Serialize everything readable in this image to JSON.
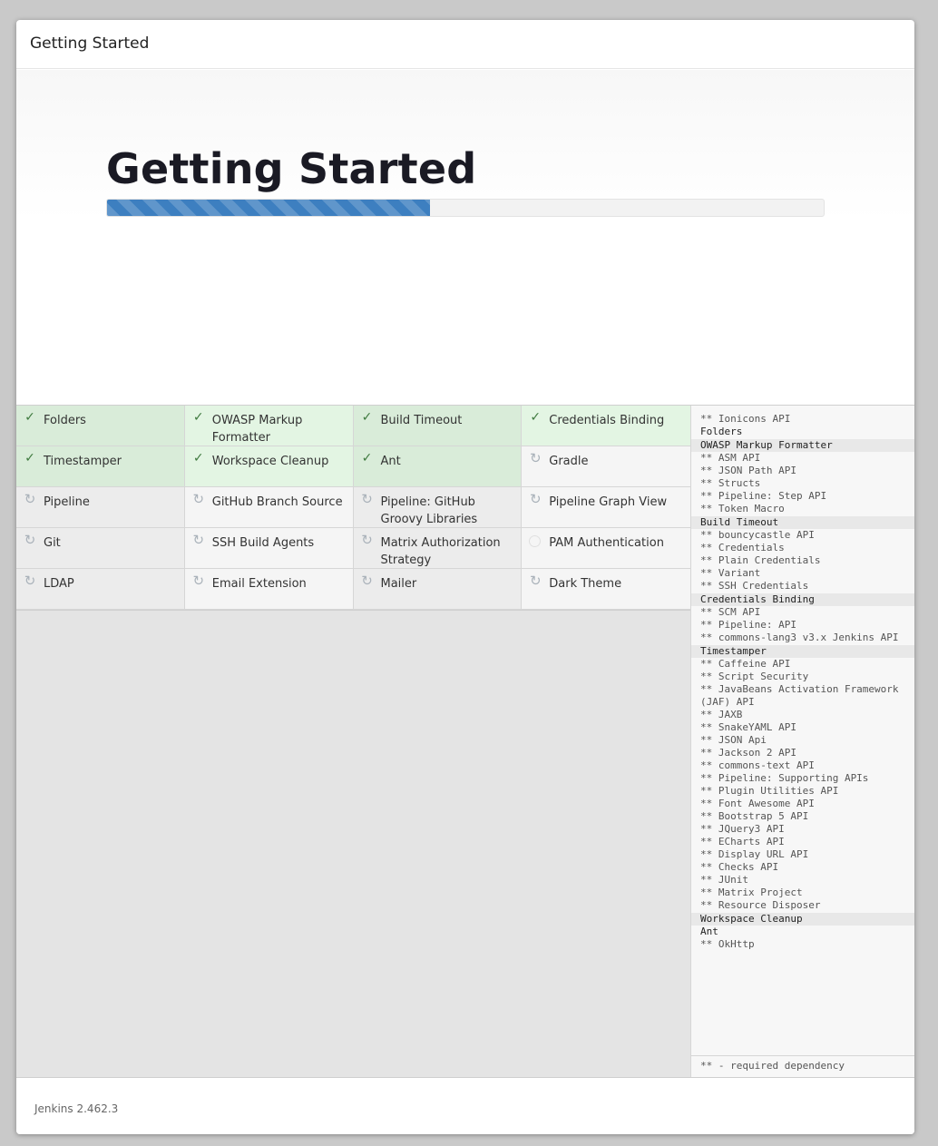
{
  "dialog": {
    "header_title": "Getting Started",
    "hero_title": "Getting Started",
    "progress_percent": 45,
    "footer_version": "Jenkins 2.462.3"
  },
  "plugins": [
    {
      "name": "Folders",
      "status": "success"
    },
    {
      "name": "OWASP Markup Formatter",
      "status": "success"
    },
    {
      "name": "Build Timeout",
      "status": "success"
    },
    {
      "name": "Credentials Binding",
      "status": "success"
    },
    {
      "name": "Timestamper",
      "status": "success"
    },
    {
      "name": "Workspace Cleanup",
      "status": "success"
    },
    {
      "name": "Ant",
      "status": "success"
    },
    {
      "name": "Gradle",
      "status": "pending"
    },
    {
      "name": "Pipeline",
      "status": "pending"
    },
    {
      "name": "GitHub Branch Source",
      "status": "pending"
    },
    {
      "name": "Pipeline: GitHub Groovy Libraries",
      "status": "pending"
    },
    {
      "name": "Pipeline Graph View",
      "status": "pending"
    },
    {
      "name": "Git",
      "status": "pending"
    },
    {
      "name": "SSH Build Agents",
      "status": "pending"
    },
    {
      "name": "Matrix Authorization Strategy",
      "status": "pending"
    },
    {
      "name": "PAM Authentication",
      "status": "idle"
    },
    {
      "name": "LDAP",
      "status": "pending"
    },
    {
      "name": "Email Extension",
      "status": "pending"
    },
    {
      "name": "Mailer",
      "status": "pending"
    },
    {
      "name": "Dark Theme",
      "status": "pending"
    }
  ],
  "log": {
    "lines": [
      {
        "text": "** Ionicons API",
        "kind": "dep"
      },
      {
        "text": "Folders",
        "kind": "top"
      },
      {
        "text": "OWASP Markup Formatter",
        "kind": "head"
      },
      {
        "text": "** ASM API",
        "kind": "dep"
      },
      {
        "text": "** JSON Path API",
        "kind": "dep"
      },
      {
        "text": "** Structs",
        "kind": "dep"
      },
      {
        "text": "** Pipeline: Step API",
        "kind": "dep"
      },
      {
        "text": "** Token Macro",
        "kind": "dep"
      },
      {
        "text": "Build Timeout",
        "kind": "head"
      },
      {
        "text": "** bouncycastle API",
        "kind": "dep"
      },
      {
        "text": "** Credentials",
        "kind": "dep"
      },
      {
        "text": "** Plain Credentials",
        "kind": "dep"
      },
      {
        "text": "** Variant",
        "kind": "dep"
      },
      {
        "text": "** SSH Credentials",
        "kind": "dep"
      },
      {
        "text": "Credentials Binding",
        "kind": "head"
      },
      {
        "text": "** SCM API",
        "kind": "dep"
      },
      {
        "text": "** Pipeline: API",
        "kind": "dep"
      },
      {
        "text": "** commons-lang3 v3.x Jenkins API",
        "kind": "dep"
      },
      {
        "text": "Timestamper",
        "kind": "head"
      },
      {
        "text": "** Caffeine API",
        "kind": "dep"
      },
      {
        "text": "** Script Security",
        "kind": "dep"
      },
      {
        "text": "** JavaBeans Activation Framework (JAF) API",
        "kind": "dep"
      },
      {
        "text": "** JAXB",
        "kind": "dep"
      },
      {
        "text": "** SnakeYAML API",
        "kind": "dep"
      },
      {
        "text": "** JSON Api",
        "kind": "dep"
      },
      {
        "text": "** Jackson 2 API",
        "kind": "dep"
      },
      {
        "text": "** commons-text API",
        "kind": "dep"
      },
      {
        "text": "** Pipeline: Supporting APIs",
        "kind": "dep"
      },
      {
        "text": "** Plugin Utilities API",
        "kind": "dep"
      },
      {
        "text": "** Font Awesome API",
        "kind": "dep"
      },
      {
        "text": "** Bootstrap 5 API",
        "kind": "dep"
      },
      {
        "text": "** JQuery3 API",
        "kind": "dep"
      },
      {
        "text": "** ECharts API",
        "kind": "dep"
      },
      {
        "text": "** Display URL API",
        "kind": "dep"
      },
      {
        "text": "** Checks API",
        "kind": "dep"
      },
      {
        "text": "** JUnit",
        "kind": "dep"
      },
      {
        "text": "** Matrix Project",
        "kind": "dep"
      },
      {
        "text": "** Resource Disposer",
        "kind": "dep"
      },
      {
        "text": "Workspace Cleanup",
        "kind": "head"
      },
      {
        "text": "Ant",
        "kind": "top"
      },
      {
        "text": "** OkHttp",
        "kind": "dep"
      }
    ],
    "footer_note": "** - required dependency"
  },
  "icons": {
    "success": "check-icon",
    "pending": "refresh-icon",
    "idle": "circle-icon"
  },
  "colors": {
    "accent": "#3d7fc0",
    "success_bg": "#d9ecd9",
    "success_check": "#3f7a3f"
  }
}
